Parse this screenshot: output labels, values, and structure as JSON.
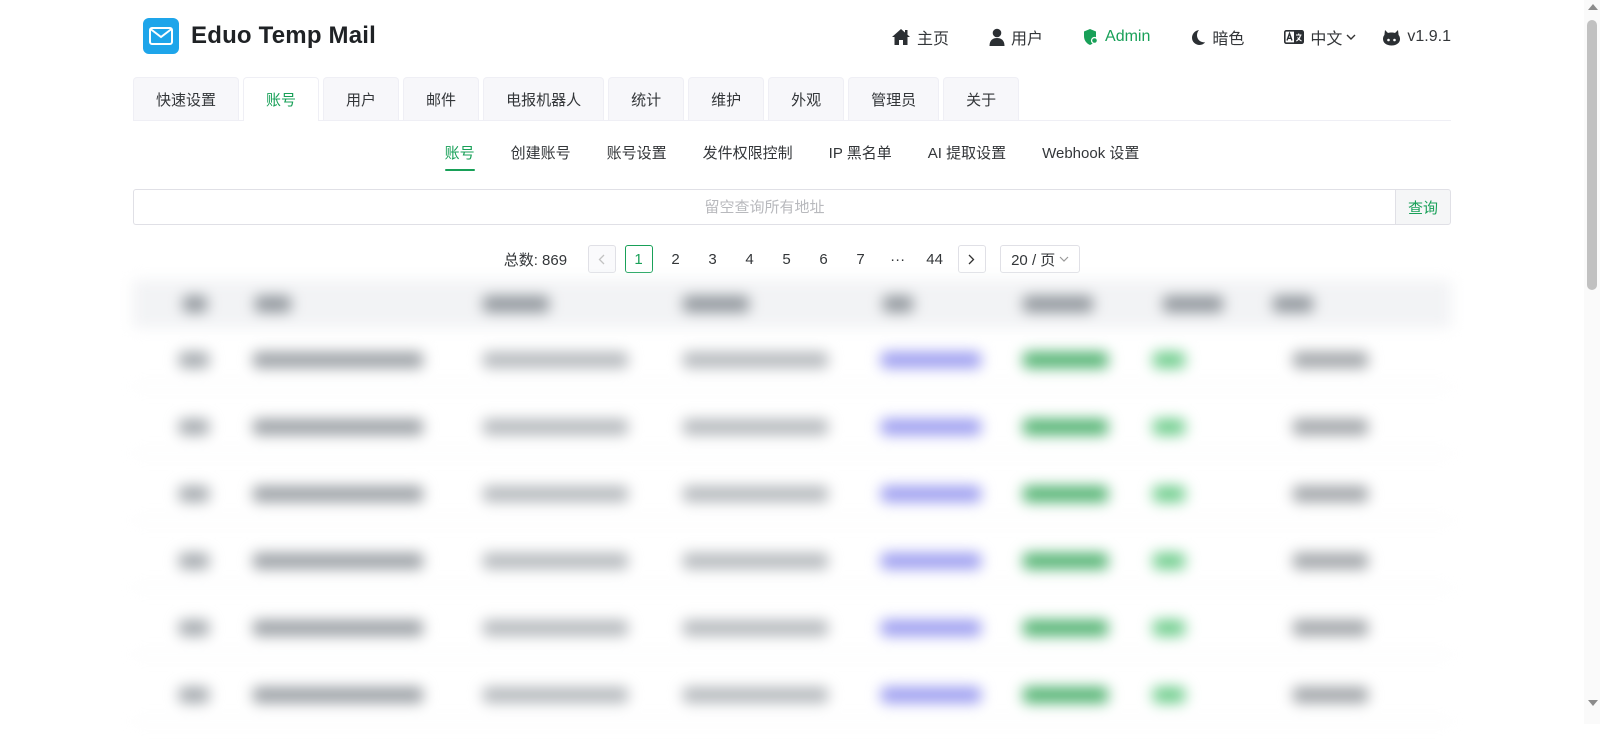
{
  "app": {
    "title": "Eduo Temp Mail",
    "logo_icon": "mail-icon",
    "brand_color": "#1ea5ea",
    "accent_color": "#18a058"
  },
  "nav": {
    "items": [
      {
        "label": "主页",
        "icon": "home-icon"
      },
      {
        "label": "用户",
        "icon": "user-icon"
      },
      {
        "label": "Admin",
        "icon": "admin-shield-icon",
        "active": true
      },
      {
        "label": "暗色",
        "icon": "moon-icon"
      },
      {
        "label": "中文",
        "icon": "translate-icon"
      },
      {
        "label": "v1.9.1",
        "icon": "github-icon"
      }
    ]
  },
  "tabs": [
    "快速设置",
    "账号",
    "用户",
    "邮件",
    "电报机器人",
    "统计",
    "维护",
    "外观",
    "管理员",
    "关于"
  ],
  "active_tab": "账号",
  "subtabs": [
    "账号",
    "创建账号",
    "账号设置",
    "发件权限控制",
    "IP 黑名单",
    "AI 提取设置",
    "Webhook 设置"
  ],
  "active_subtab": "账号",
  "search": {
    "placeholder": "留空查询所有地址",
    "button_label": "查询"
  },
  "pagination": {
    "total_label": "总数: 869",
    "pages": [
      "1",
      "2",
      "3",
      "4",
      "5",
      "6",
      "7",
      "···",
      "44"
    ],
    "current": "1",
    "page_size_label": "20 / 页"
  },
  "table": {
    "blurred": true,
    "visible_rows": 6
  }
}
